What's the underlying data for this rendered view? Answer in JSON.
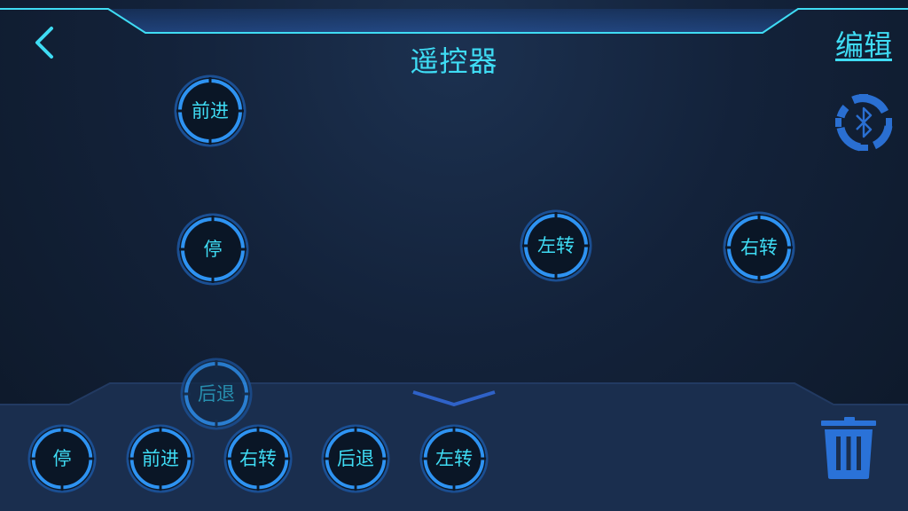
{
  "header": {
    "title": "遥控器",
    "edit_label": "编辑"
  },
  "canvas_buttons": [
    {
      "id": "forward",
      "label": "前进"
    },
    {
      "id": "stop",
      "label": "停"
    },
    {
      "id": "turn-left",
      "label": "左转"
    },
    {
      "id": "turn-right",
      "label": "右转"
    },
    {
      "id": "backward-dragging",
      "label": "后退"
    }
  ],
  "palette": [
    {
      "id": "stop",
      "label": "停"
    },
    {
      "id": "forward",
      "label": "前进"
    },
    {
      "id": "turn-right",
      "label": "右转"
    },
    {
      "id": "backward",
      "label": "后退"
    },
    {
      "id": "turn-left",
      "label": "左转"
    }
  ],
  "icons": {
    "back": "chevron-left-icon",
    "bluetooth_settings": "bluetooth-gear-icon",
    "collapse": "chevron-down-icon",
    "delete": "trash-icon"
  },
  "colors": {
    "accent": "#3fdcf4",
    "ring": "#2a8ff0",
    "trash": "#2a72d8",
    "tray": "#1a2e4e"
  }
}
